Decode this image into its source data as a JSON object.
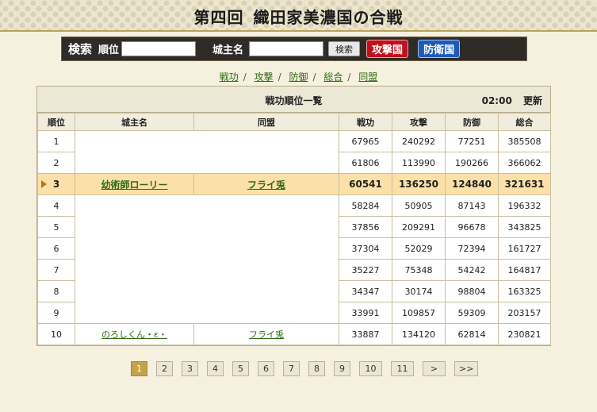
{
  "header": {
    "title_a": "第四回",
    "title_b": "織田家美濃国の合戦"
  },
  "search": {
    "title": "検索",
    "rank_label": "順位",
    "rank_value": "",
    "lord_label": "城主名",
    "lord_value": "",
    "search_button": "検索",
    "attack_button": "攻撃国",
    "defense_button": "防衛国"
  },
  "filters": [
    "戦功",
    "攻撃",
    "防御",
    "総合",
    "同盟"
  ],
  "table": {
    "title": "戦功順位一覧",
    "update_time": "02:00",
    "update_button": "更新",
    "columns": [
      "順位",
      "城主名",
      "同盟",
      "戦功",
      "攻撃",
      "防御",
      "総合"
    ],
    "rows": [
      {
        "rank": "1",
        "lord": "",
        "alliance": "",
        "merit": "67965",
        "attack": "240292",
        "defense": "77251",
        "total": "385508"
      },
      {
        "rank": "2",
        "lord": "",
        "alliance": "",
        "merit": "61806",
        "attack": "113990",
        "defense": "190266",
        "total": "366062"
      },
      {
        "rank": "3",
        "lord": "幼術師ローリー",
        "alliance": "フライ兎",
        "merit": "60541",
        "attack": "136250",
        "defense": "124840",
        "total": "321631"
      },
      {
        "rank": "4",
        "lord": "",
        "alliance": "",
        "merit": "58284",
        "attack": "50905",
        "defense": "87143",
        "total": "196332"
      },
      {
        "rank": "5",
        "lord": "",
        "alliance": "",
        "merit": "37856",
        "attack": "209291",
        "defense": "96678",
        "total": "343825"
      },
      {
        "rank": "6",
        "lord": "",
        "alliance": "",
        "merit": "37304",
        "attack": "52029",
        "defense": "72394",
        "total": "161727"
      },
      {
        "rank": "7",
        "lord": "",
        "alliance": "",
        "merit": "35227",
        "attack": "75348",
        "defense": "54242",
        "total": "164817"
      },
      {
        "rank": "8",
        "lord": "",
        "alliance": "",
        "merit": "34347",
        "attack": "30174",
        "defense": "98804",
        "total": "163325"
      },
      {
        "rank": "9",
        "lord": "",
        "alliance": "",
        "merit": "33991",
        "attack": "109857",
        "defense": "59309",
        "total": "203157"
      },
      {
        "rank": "10",
        "lord": "のろしくん・ε・",
        "alliance": "フライ兎",
        "merit": "33887",
        "attack": "134120",
        "defense": "62814",
        "total": "230821"
      }
    ]
  },
  "pager": {
    "pages": [
      "1",
      "2",
      "3",
      "4",
      "5",
      "6",
      "7",
      "8",
      "9",
      "10",
      "11"
    ],
    "current": "1",
    "next": ">",
    "last": ">>"
  }
}
